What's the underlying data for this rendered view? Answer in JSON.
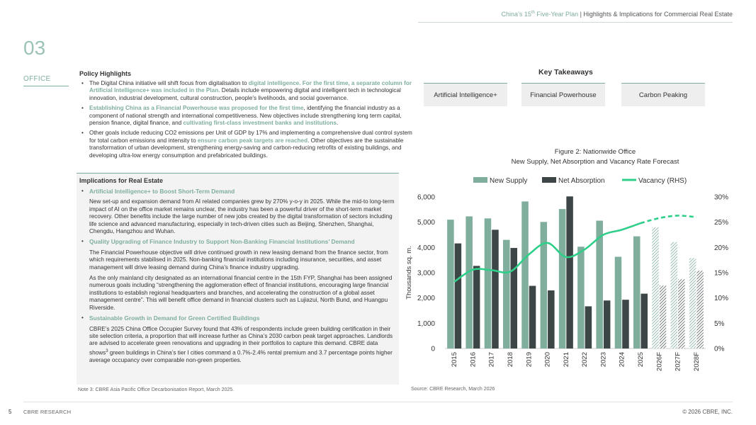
{
  "header": {
    "plan_prefix": "China’s 15",
    "plan_sup": "th",
    "plan_suffix": " Five-Year Plan",
    "separator": " | ",
    "subtitle": "Highlights & Implications for Commercial Real Estate"
  },
  "section": {
    "number": "03",
    "label": "OFFICE"
  },
  "policy": {
    "heading": "Policy Highlights",
    "b1": {
      "t1": "The Digital China initiative will shift focus from digitalisation to ",
      "h1": "digital intelligence. For the first time, a separate column for Artificial Intelligence+ was included in the Plan.",
      "t2": " Details include empowering digital and intelligent tech in technological innovation, industrial development, cultural construction, people’s livelihoods, and social governance."
    },
    "b2": {
      "h1": "Establishing China as a Financial Powerhouse was proposed for the first time",
      "t1": ", identifying the financial industry as a component of national strength and international competitiveness. New objectives include strengthening long term capital, pension finance, digital finance, and ",
      "h2": "cultivating first-class investment banks and institutions",
      "t2": "."
    },
    "b3": {
      "t1": "Other goals include reducing CO2 emissions per Unit of GDP by 17% and implementing a comprehensive dual control system for total carbon emissions and intensity to ",
      "h1": "ensure carbon peak targets are reached",
      "t2": ". Other objectives are the sustainable transformation of urban development, strengthening energy-saving and carbon-reducing retrofits of existing buildings, and developing ultra-low energy consumption and prefabricated buildings."
    }
  },
  "implications": {
    "heading": "Implications for Real Estate",
    "s1": {
      "title": "Artificial Intelligence+ to Boost Short-Term Demand",
      "p1": "New set-up and expansion demand from AI related companies grew by 270% y-o-y in 2025. While the mid-to long-term impact of AI on the office market remains unclear, the industry has been a powerful driver of the short-term market recovery. Other benefits include the large number of new jobs created by the digital transformation of sectors including life science and advanced manufacturing, especially in tech-driven cities such as Beijing, Shenzhen, Shanghai, Chengdu, Hangzhou and Wuhan."
    },
    "s2": {
      "title": "Quality Upgrading of Finance Industry to Support Non-Banking Financial Institutions’ Demand",
      "p1": "The Financial Powerhouse objective will drive continued growth in new leasing demand from the finance sector, from which requirements stabilised in 2025. Non-banking financial institutions including insurance, securities, and asset management will drive leasing demand during China’s finance industry upgrading.",
      "p2": "As the only mainland city designated as an international financial centre in the 15th FYP, Shanghai has been assigned numerous goals including “strengthening the agglomeration effect of financial institutions, encouraging large financial institutions to establish regional headquarters and branches, and accelerating the construction of a global asset management centre”. This will benefit office demand in financial clusters such as Lujiazui, North Bund, and Huangpu Riverside."
    },
    "s3": {
      "title": "Sustainable Growth in Demand for Green Certified Buildings",
      "p1a": "CBRE’s 2025 China Office Occupier Survey found that 43% of respondents include green building certification in their site selection criteria, a proportion that will increase further as China’s 2030 carbon peak target approaches. Landlords are advised to accelerate green renovations and upgrading in their portfolios to capture this demand. CBRE data shows",
      "p1sup": "3",
      "p1b": " green buildings in China’s tier I cities command a 0.7%-2.4% rental premium and 3.7 percentage points higher average occupancy over comparable non-green properties."
    }
  },
  "note": "Note 3: CBRE Asia Pacific Office Decarbonisation Report, March 2025.",
  "takeaways": {
    "heading": "Key Takeaways",
    "items": [
      "Artificial Intelligence+",
      "Financial Powerhouse",
      "Carbon Peaking"
    ]
  },
  "figure": {
    "title_line1": "Figure 2: Nationwide Office",
    "title_line2": "New Supply, Net Absorption and Vacancy Rate Forecast",
    "source": "Source: CBRE Research, March 2026"
  },
  "chart_data": {
    "type": "bar",
    "categories": [
      "2015",
      "2016",
      "2017",
      "2018",
      "2019",
      "2020",
      "2021",
      "2022",
      "2023",
      "2024",
      "2025",
      "2026F",
      "2027F",
      "2028F"
    ],
    "forecast_from_index": 11,
    "series": [
      {
        "name": "New Supply",
        "kind": "bar",
        "axis": "left",
        "color": "#7fae9c",
        "values": [
          5100,
          5230,
          5150,
          4300,
          5820,
          5010,
          5520,
          4030,
          5060,
          3630,
          4440,
          4800,
          4210,
          3580
        ]
      },
      {
        "name": "Net Absorption",
        "kind": "bar",
        "axis": "left",
        "color": "#3d4647",
        "values": [
          4160,
          3270,
          4700,
          3980,
          2480,
          2300,
          6020,
          1670,
          1900,
          1930,
          2170,
          2490,
          2740,
          3080
        ]
      },
      {
        "name": "Vacancy (RHS)",
        "kind": "line",
        "axis": "right",
        "color": "#2fcf8a",
        "values": [
          13.2,
          15.6,
          15.5,
          15.2,
          18.6,
          20.9,
          18.1,
          19.6,
          22.5,
          23.5,
          24.8,
          25.8,
          26.3,
          26.0
        ]
      }
    ],
    "ylabel": "Thousands sq. m.",
    "ylim": [
      0,
      6000
    ],
    "yticks": [
      "0",
      "1,000",
      "2,000",
      "3,000",
      "4,000",
      "5,000",
      "6,000"
    ],
    "y2lim": [
      0,
      30
    ],
    "y2ticks": [
      "0%",
      "5%",
      "10%",
      "15%",
      "20%",
      "25%",
      "30%"
    ],
    "legend": "top",
    "grid": false
  },
  "footer": {
    "page": "5",
    "brand": "CBRE RESEARCH",
    "copyright": "© 2026 CBRE, INC."
  }
}
